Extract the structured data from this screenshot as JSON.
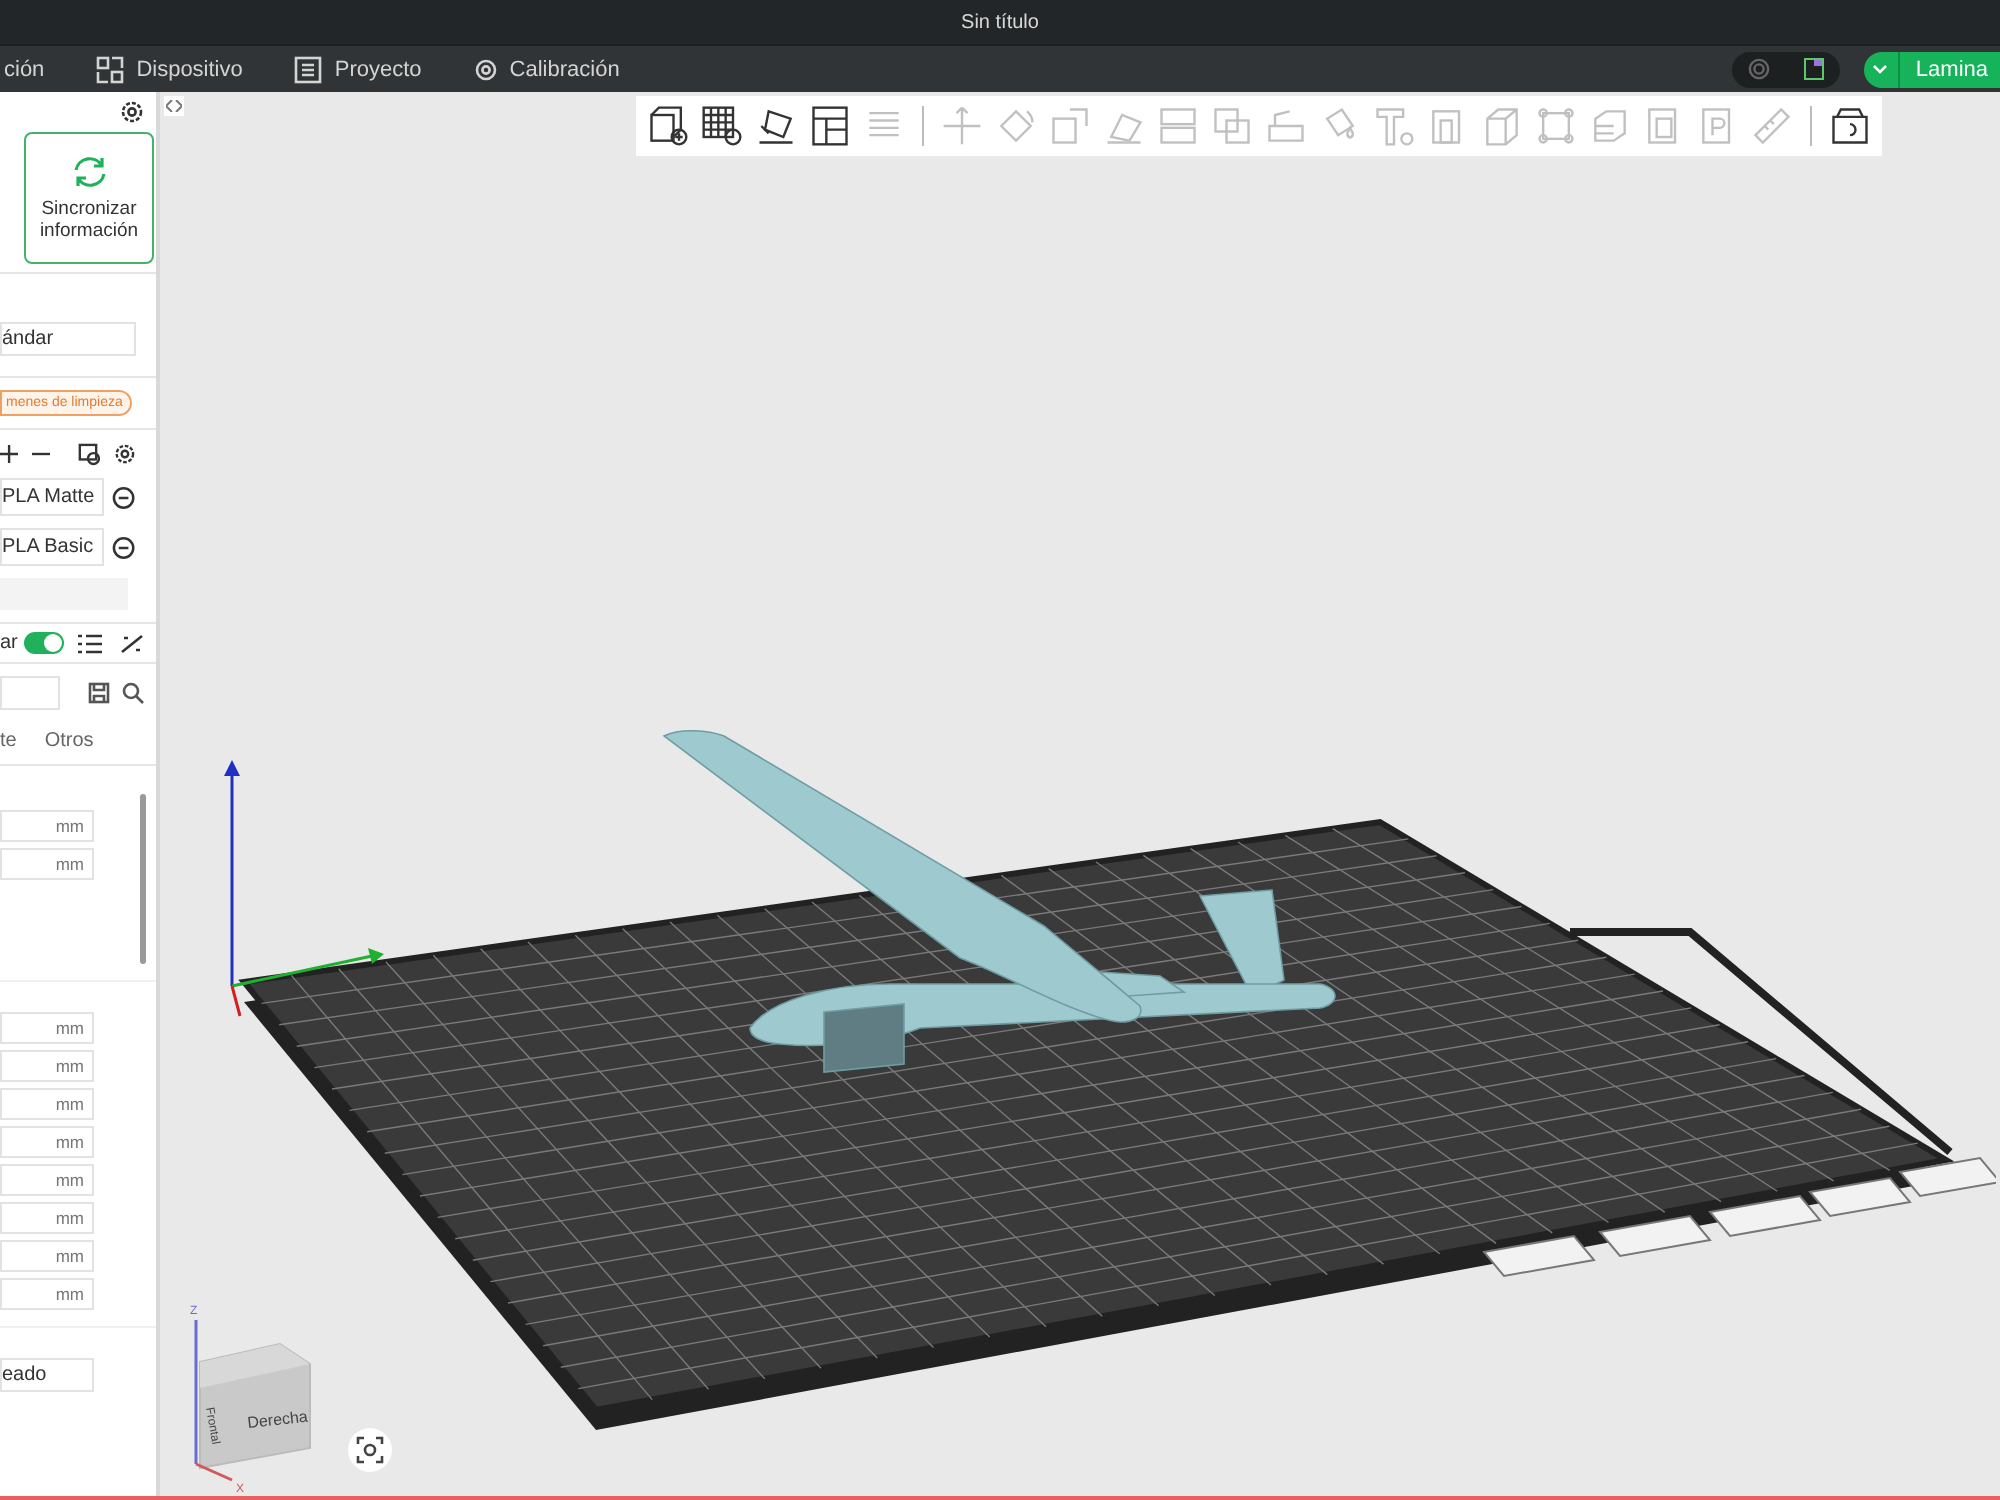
{
  "window": {
    "title": "Sin título"
  },
  "menu": {
    "tabs": [
      {
        "label": "ción",
        "selected": false
      },
      {
        "label": "Dispositivo",
        "selected": false
      },
      {
        "label": "Proyecto",
        "selected": false
      },
      {
        "label": "Calibración",
        "selected": false
      }
    ]
  },
  "slice_button": {
    "label": "Lamina"
  },
  "toolbar": {
    "tools": [
      {
        "disabled": false
      },
      {
        "disabled": false
      },
      {
        "disabled": false
      },
      {
        "disabled": false
      },
      {
        "disabled": true
      },
      {
        "disabled": true
      },
      {
        "disabled": true
      },
      {
        "disabled": true
      },
      {
        "disabled": true
      },
      {
        "disabled": true
      },
      {
        "disabled": true
      },
      {
        "disabled": true
      },
      {
        "disabled": true
      },
      {
        "disabled": true
      },
      {
        "disabled": true
      },
      {
        "disabled": true
      },
      {
        "disabled": true
      },
      {
        "disabled": true
      },
      {
        "disabled": true
      },
      {
        "disabled": true
      },
      {
        "disabled": true
      },
      {
        "disabled": false
      }
    ]
  },
  "printer": {
    "sync_button": "Sincronizar\ninformación",
    "plate_value": "ándar"
  },
  "filaments": {
    "badge": "menes de limpieza",
    "items": [
      {
        "name": "PLA Matte"
      },
      {
        "name": "PLA Basic"
      }
    ]
  },
  "process": {
    "toggle_label": "ar",
    "toggle_on": true,
    "tabs": [
      {
        "label": "te",
        "selected": false
      },
      {
        "label": "Otros",
        "selected": false
      }
    ],
    "groups": [
      {
        "fields": [
          {
            "unit": "mm"
          },
          {
            "unit": "mm"
          }
        ]
      },
      {
        "fields": [
          {
            "unit": "mm"
          },
          {
            "unit": "mm"
          },
          {
            "unit": "mm"
          },
          {
            "unit": "mm"
          },
          {
            "unit": "mm"
          },
          {
            "unit": "mm"
          },
          {
            "unit": "mm"
          },
          {
            "unit": "mm"
          }
        ]
      }
    ],
    "select_value": "eado"
  },
  "view_cube": {
    "front": "Frontal",
    "right": "Derecha",
    "z": "Z",
    "x": "X"
  }
}
